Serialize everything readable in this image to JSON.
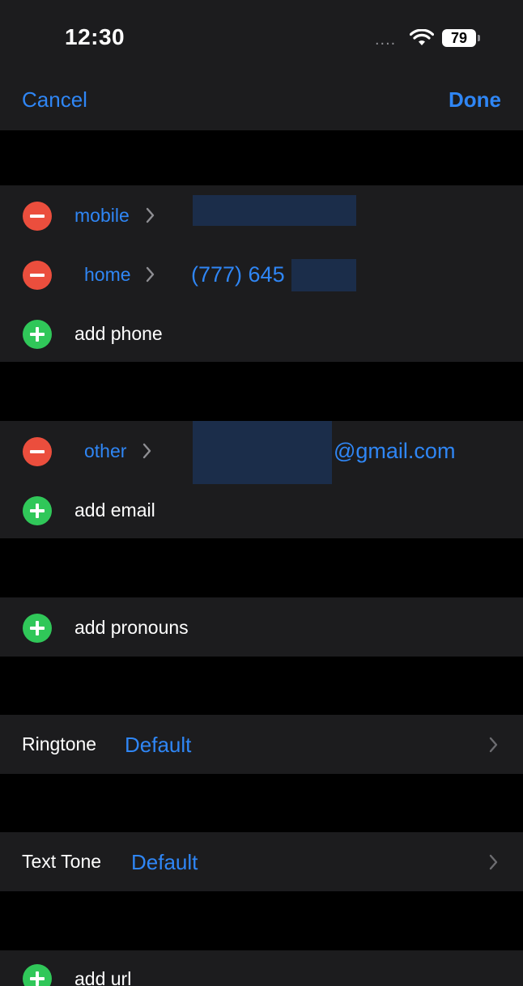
{
  "status_bar": {
    "time": "12:30",
    "signal": "....",
    "battery": "79"
  },
  "nav": {
    "cancel": "Cancel",
    "done": "Done"
  },
  "phones": {
    "items": [
      {
        "label": "mobile",
        "value": ""
      },
      {
        "label": "home",
        "value": "(777) 645"
      }
    ],
    "add_label": "add phone"
  },
  "emails": {
    "items": [
      {
        "label": "other",
        "value": "@gmail.com"
      }
    ],
    "add_label": "add email"
  },
  "pronouns": {
    "add_label": "add pronouns"
  },
  "ringtone": {
    "label": "Ringtone",
    "value": "Default"
  },
  "text_tone": {
    "label": "Text Tone",
    "value": "Default"
  },
  "url": {
    "add_label": "add url"
  },
  "colors": {
    "accent_blue": "#2f86f5",
    "remove_red": "#eb4e3d",
    "add_green": "#30c759",
    "panel": "#1c1c1e",
    "background": "#000000"
  }
}
